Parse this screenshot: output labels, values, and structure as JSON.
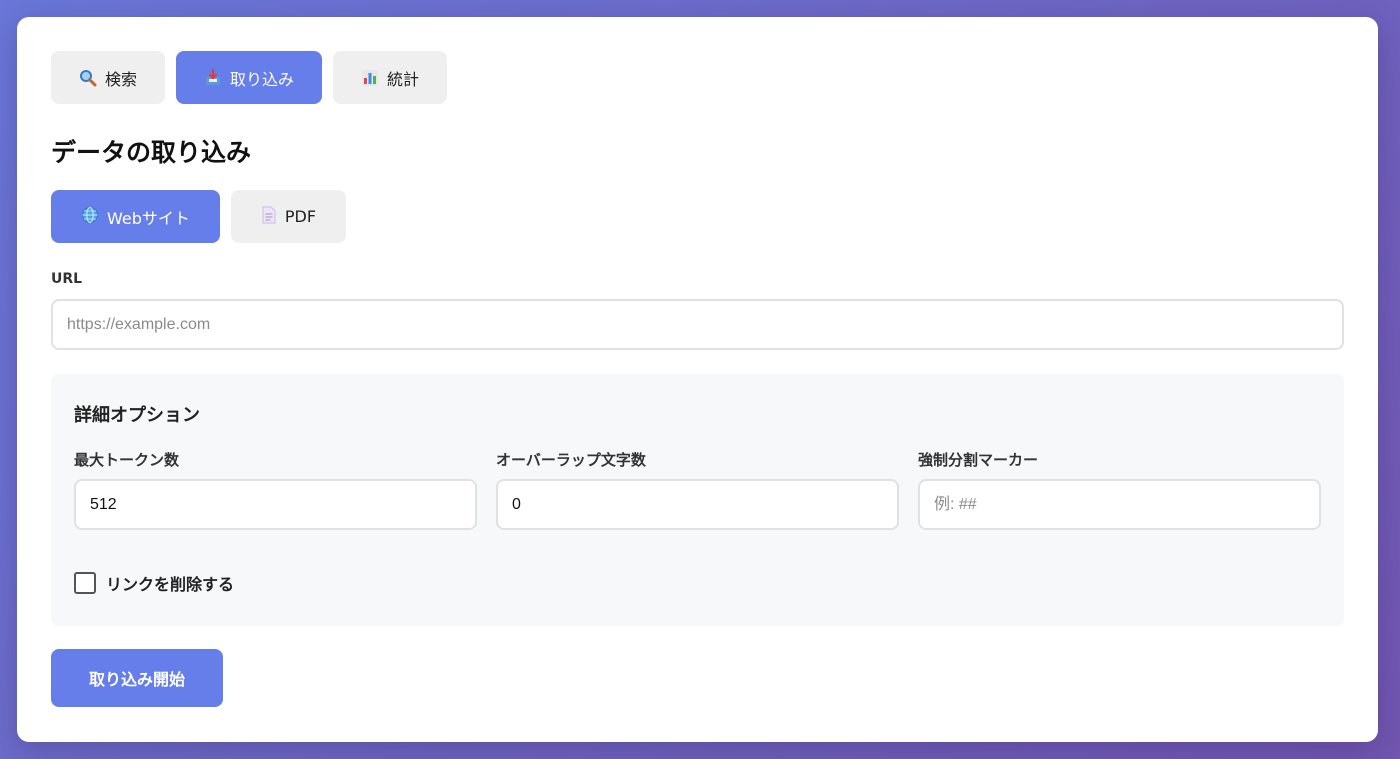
{
  "tabs": [
    {
      "label": "検索",
      "icon": "magnifier-icon",
      "active": false
    },
    {
      "label": "取り込み",
      "icon": "inbox-tray-icon",
      "active": true
    },
    {
      "label": "統計",
      "icon": "bar-chart-icon",
      "active": false
    }
  ],
  "page_title": "データの取り込み",
  "source_tabs": [
    {
      "label": "Webサイト",
      "icon": "globe-icon",
      "active": true
    },
    {
      "label": "PDF",
      "icon": "document-icon",
      "active": false
    }
  ],
  "url": {
    "label": "URL",
    "value": "",
    "placeholder": "https://example.com"
  },
  "options": {
    "title": "詳細オプション",
    "max_tokens": {
      "label": "最大トークン数",
      "value": "512",
      "placeholder": ""
    },
    "overlap": {
      "label": "オーバーラップ文字数",
      "value": "0",
      "placeholder": ""
    },
    "split_marker": {
      "label": "強制分割マーカー",
      "value": "",
      "placeholder": "例: ##"
    },
    "remove_links": {
      "label": "リンクを削除する",
      "checked": false
    }
  },
  "submit_label": "取り込み開始",
  "colors": {
    "accent": "#667eea",
    "tab_bg": "#efefef",
    "options_bg": "#f7f8fa"
  }
}
